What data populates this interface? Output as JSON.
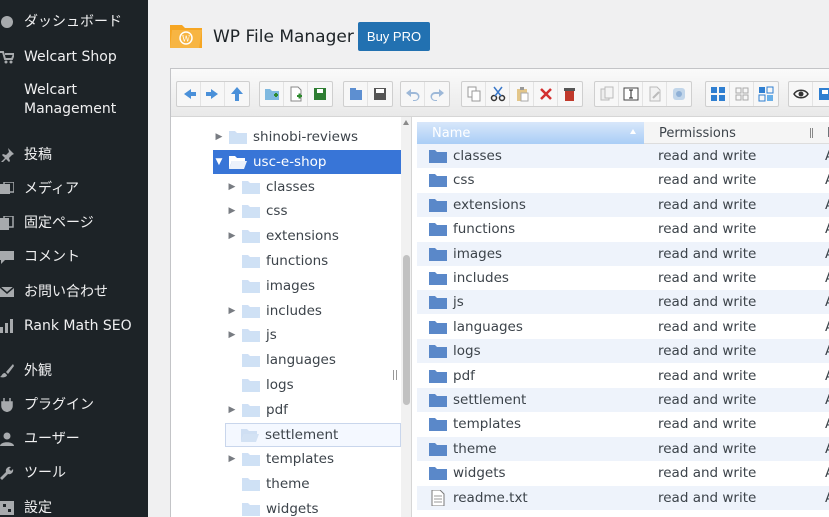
{
  "sidebar": {
    "items": [
      {
        "label": "ダッシュボード",
        "icon": "dashboard-icon"
      },
      {
        "label": "Welcart Shop",
        "icon": "cart-icon"
      },
      {
        "label": "Welcart Management",
        "icon": "cart-icon"
      },
      {
        "label": "投稿",
        "icon": "pin-icon"
      },
      {
        "label": "メディア",
        "icon": "media-icon"
      },
      {
        "label": "固定ページ",
        "icon": "pages-icon"
      },
      {
        "label": "コメント",
        "icon": "comment-icon"
      },
      {
        "label": "お問い合わせ",
        "icon": "mail-icon"
      },
      {
        "label": "Rank Math SEO",
        "icon": "chart-icon"
      },
      {
        "label": "外観",
        "icon": "brush-icon"
      },
      {
        "label": "プラグイン",
        "icon": "plugin-icon"
      },
      {
        "label": "ユーザー",
        "icon": "user-icon"
      },
      {
        "label": "ツール",
        "icon": "wrench-icon"
      },
      {
        "label": "設定",
        "icon": "settings-icon"
      }
    ]
  },
  "header": {
    "title": "WP File Manager",
    "buy_pro": "Buy PRO"
  },
  "toolbar": {
    "groups": [
      [
        "back-icon",
        "forward-icon",
        "up-icon"
      ],
      [
        "mkdir-icon",
        "mkfile-icon",
        "upload-icon"
      ],
      [
        "open-icon",
        "save-icon"
      ],
      [
        "undo-icon",
        "redo-icon"
      ],
      [
        "copy-icon",
        "cut-icon",
        "paste-icon",
        "delete-icon",
        "empty-icon"
      ],
      [
        "duplicate-icon",
        "rename-icon",
        "edit-icon",
        "resize-icon"
      ],
      [
        "grid-view-icon",
        "icons-view-icon",
        "list-view-icon"
      ],
      [
        "preview-icon",
        "info-icon"
      ]
    ]
  },
  "tree": {
    "items": [
      {
        "label": "shinobi-reviews",
        "depth": 0,
        "arrow": "right"
      },
      {
        "label": "usc-e-shop",
        "depth": 0,
        "arrow": "down",
        "selected": true
      },
      {
        "label": "classes",
        "depth": 1,
        "arrow": "right"
      },
      {
        "label": "css",
        "depth": 1,
        "arrow": "right"
      },
      {
        "label": "extensions",
        "depth": 1,
        "arrow": "right"
      },
      {
        "label": "functions",
        "depth": 1,
        "arrow": ""
      },
      {
        "label": "images",
        "depth": 1,
        "arrow": ""
      },
      {
        "label": "includes",
        "depth": 1,
        "arrow": "right"
      },
      {
        "label": "js",
        "depth": 1,
        "arrow": "right"
      },
      {
        "label": "languages",
        "depth": 1,
        "arrow": ""
      },
      {
        "label": "logs",
        "depth": 1,
        "arrow": ""
      },
      {
        "label": "pdf",
        "depth": 1,
        "arrow": "right"
      },
      {
        "label": "settlement",
        "depth": 1,
        "arrow": "",
        "hover": true
      },
      {
        "label": "templates",
        "depth": 1,
        "arrow": "right"
      },
      {
        "label": "theme",
        "depth": 1,
        "arrow": ""
      },
      {
        "label": "widgets",
        "depth": 1,
        "arrow": ""
      }
    ]
  },
  "list": {
    "headers": {
      "name": "Name",
      "permissions": "Permissions",
      "extra": "I"
    },
    "rows": [
      {
        "name": "classes",
        "perm": "read and write",
        "extra": "A",
        "type": "folder"
      },
      {
        "name": "css",
        "perm": "read and write",
        "extra": "A",
        "type": "folder"
      },
      {
        "name": "extensions",
        "perm": "read and write",
        "extra": "A",
        "type": "folder"
      },
      {
        "name": "functions",
        "perm": "read and write",
        "extra": "A",
        "type": "folder"
      },
      {
        "name": "images",
        "perm": "read and write",
        "extra": "A",
        "type": "folder"
      },
      {
        "name": "includes",
        "perm": "read and write",
        "extra": "A",
        "type": "folder"
      },
      {
        "name": "js",
        "perm": "read and write",
        "extra": "A",
        "type": "folder"
      },
      {
        "name": "languages",
        "perm": "read and write",
        "extra": "A",
        "type": "folder"
      },
      {
        "name": "logs",
        "perm": "read and write",
        "extra": "A",
        "type": "folder"
      },
      {
        "name": "pdf",
        "perm": "read and write",
        "extra": "A",
        "type": "folder"
      },
      {
        "name": "settlement",
        "perm": "read and write",
        "extra": "A",
        "type": "folder"
      },
      {
        "name": "templates",
        "perm": "read and write",
        "extra": "A",
        "type": "folder"
      },
      {
        "name": "theme",
        "perm": "read and write",
        "extra": "A",
        "type": "folder"
      },
      {
        "name": "widgets",
        "perm": "read and write",
        "extra": "A",
        "type": "folder"
      },
      {
        "name": "readme.txt",
        "perm": "read and write",
        "extra": "A",
        "type": "file"
      }
    ]
  },
  "colors": {
    "sidebar_bg": "#1d2327",
    "accent": "#2271b1",
    "selected": "#3875d7",
    "folder": "#5a88c9"
  }
}
